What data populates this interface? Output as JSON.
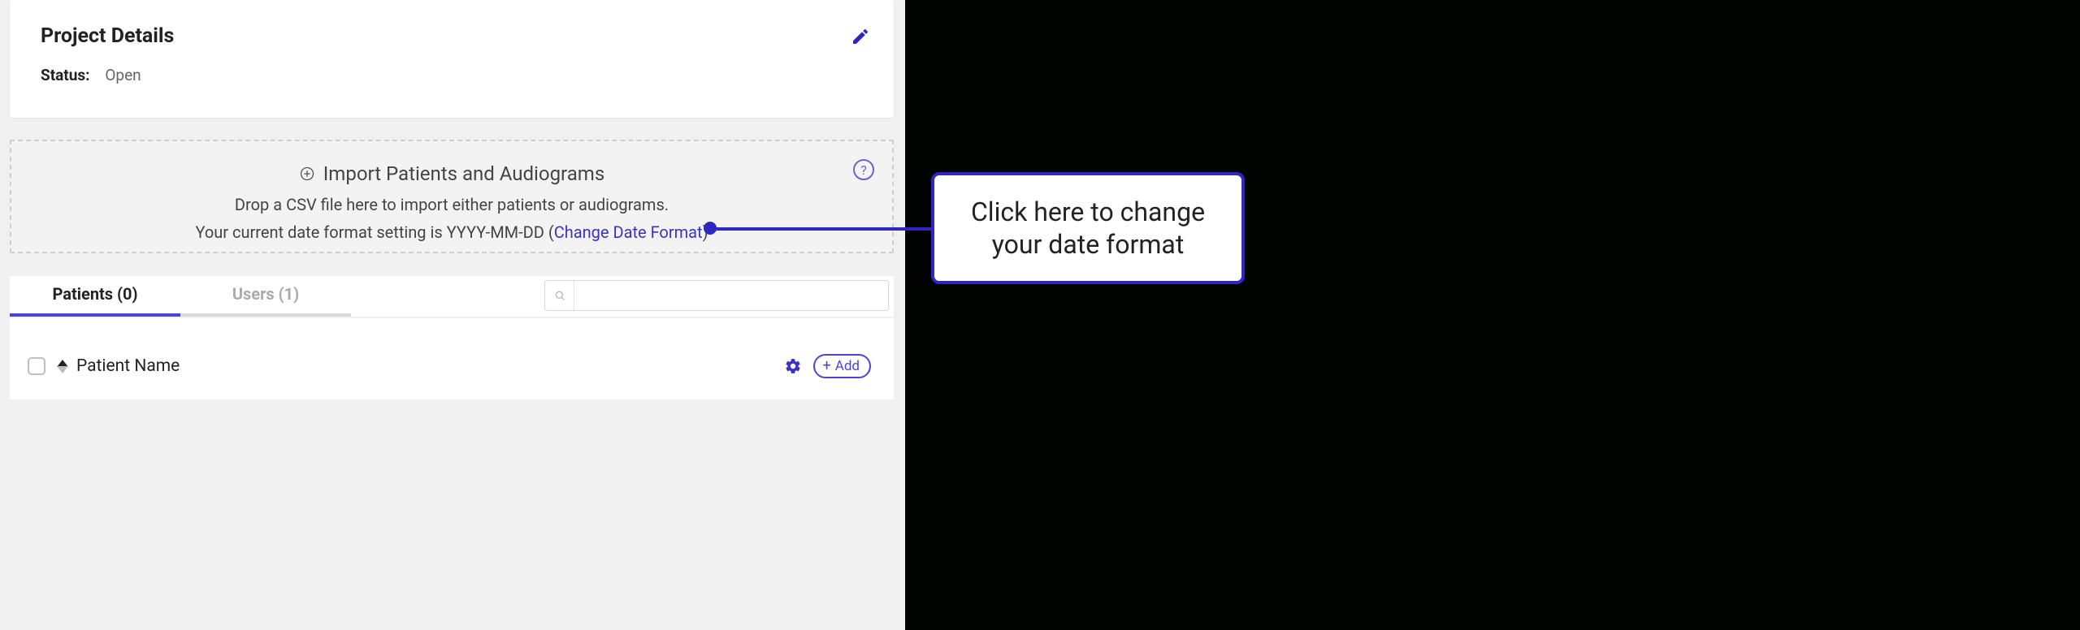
{
  "details": {
    "title": "Project Details",
    "status_label": "Status:",
    "status_value": "Open"
  },
  "dropzone": {
    "heading": "Import Patients and Audiograms",
    "subtext": "Drop a CSV file here to import either patients or audiograms.",
    "line3_prefix": "Your current date format setting is YYYY-MM-DD  (",
    "link_text": "Change Date Format",
    "line3_suffix": ")"
  },
  "tabs": {
    "patients": "Patients (0)",
    "users": "Users (1)"
  },
  "search": {
    "value": ""
  },
  "table": {
    "column_label": "Patient Name",
    "add_label": "Add"
  },
  "callout": {
    "text": "Click here to change your date format"
  }
}
